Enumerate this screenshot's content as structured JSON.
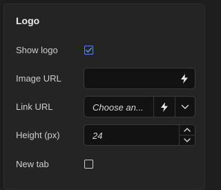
{
  "section": {
    "title": "Logo"
  },
  "fields": {
    "show_logo": {
      "label": "Show logo",
      "checked": true
    },
    "image_url": {
      "label": "Image URL",
      "value": "",
      "action_icon": "lightning-bolt-icon"
    },
    "link_url": {
      "label": "Link URL",
      "value": "Choose an...",
      "action_icon": "lightning-bolt-icon",
      "dropdown_icon": "chevron-down-icon"
    },
    "height": {
      "label": "Height (px)",
      "value": "24",
      "stepper_icons": [
        "chevron-up-icon",
        "chevron-down-icon"
      ]
    },
    "new_tab": {
      "label": "New tab",
      "checked": false
    }
  },
  "colors": {
    "accent": "#4a8ff7",
    "panel": "#242424",
    "input_bg": "#121212"
  }
}
